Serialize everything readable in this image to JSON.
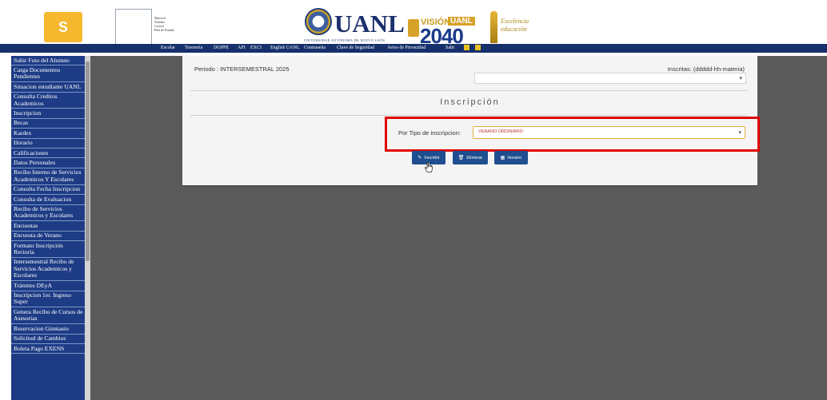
{
  "header": {
    "logo_letter": "S",
    "student_info": [
      "Matrícul",
      "Nombre",
      "Carrera",
      "Plan de Estudio"
    ],
    "uanl_title": "UANL",
    "uanl_subtitle": "UNIVERSIDAD AUTÓNOMA DE NUEVO LEÓN",
    "vision_label": "VISIÓN",
    "vision_badge": "UANL",
    "vision_year": "2040",
    "excellence_line1": "Excelencia",
    "excellence_line2": "educación"
  },
  "nav": {
    "items": [
      "Escolar",
      "Tesorería",
      "DGPPE",
      "AFI",
      "EXCI",
      "English UANL",
      "Contraseña",
      "Clave de Seguridad",
      "Aviso de Privacidad",
      "Salir"
    ]
  },
  "sidebar": {
    "items": [
      "Subir Foto del Alumno",
      "Carga Documentos Pendientes",
      "Situacion estudiante UANL",
      "Consulta Creditos Academicos",
      "Inscripcion",
      "Becas",
      "Kardex",
      "Horario",
      "Calificaciones",
      "Datos Personales",
      "Recibo Interno de Servicios Academicos Y Escolares",
      "Consulta Fecha Inscripcion",
      "Consulta de Evaluacion",
      "Recibo de Servicios Academicos y Escolares",
      "Encuestas",
      "Encuesta de Verano",
      "Formato Inscripción Rectoria",
      "Intersemestral Recibo de Servicios Academicos y Escolares",
      "Trámites DEyA",
      "Inscripcion 1er. Ingreso Super",
      "Genera Recibo de Cursos de Asesorias",
      "Reservacion Gimnasio",
      "Solicitud de Cambios",
      "Boleta Pago EXENS"
    ]
  },
  "main": {
    "periodo": "Periodo : INTERSEMESTRAL 2025",
    "inscritas": "Inscritas: (ddddd-hh-materia)",
    "title": "Inscripción",
    "tipo_label": "Por Tipo de inscripcion:",
    "tipo_value": "VERANO ORDINARIO",
    "buttons": {
      "inscribir": "Inscribir",
      "eliminar": "Eliminar",
      "horario": "Horario"
    }
  },
  "colors": {
    "nav_bg": "#16306b",
    "sidebar_bg": "#1e3c85",
    "content_bg": "#5b5b5b",
    "highlight": "#e00000",
    "button_bg": "#1f4e90",
    "logo_bg": "#f5b82e"
  },
  "icons": {
    "inscribir": "pencil-icon",
    "eliminar": "trash-icon",
    "horario": "calendar-icon"
  }
}
